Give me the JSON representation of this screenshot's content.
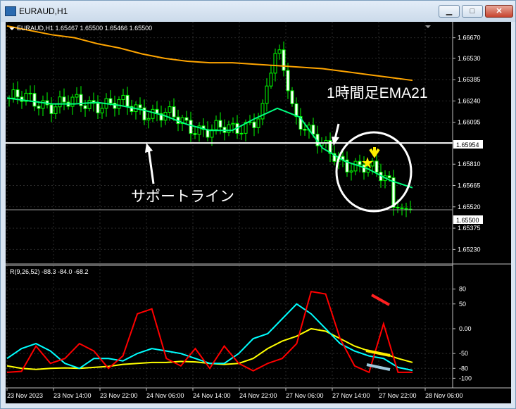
{
  "window": {
    "title": "EURAUD,H1"
  },
  "main_chart": {
    "header": "EURAUD,H1  1.65467 1.65500 1.65466 1.65500",
    "price_ticks": [
      "1.66670",
      "1.66530",
      "1.66385",
      "1.66240",
      "1.66095",
      "1.65954",
      "1.65810",
      "1.65665",
      "1.65520",
      "1.65500",
      "1.65375",
      "1.65230"
    ],
    "support_price_label": "1.65954",
    "current_price_label": "1.65500",
    "ylim": [
      1.6516,
      1.6674
    ]
  },
  "annotations": {
    "ema_label": "1時間足EMA21",
    "support_label": "サポートライン"
  },
  "indicator": {
    "header": "R(9,26,52) -88.3 -84.0 -68.2",
    "ticks": [
      "80",
      "50",
      "0.00",
      "-50",
      "-80",
      "-100"
    ],
    "ylim": [
      -108,
      88
    ]
  },
  "time_axis": {
    "labels": [
      "23 Nov 2023",
      "23 Nov 14:00",
      "23 Nov 22:00",
      "24 Nov 06:00",
      "24 Nov 14:00",
      "24 Nov 22:00",
      "27 Nov 06:00",
      "27 Nov 14:00",
      "27 Nov 22:00",
      "28 Nov 06:00"
    ]
  },
  "colors": {
    "background": "#000000",
    "candle": "#00ff00",
    "ema21": "#00ff7f",
    "slow_ma": "#ffa500",
    "support_line": "#ffffff",
    "indicator_fast": "#ff0000",
    "indicator_mid": "#00ffff",
    "indicator_slow": "#ffff00",
    "annotation_circle": "#ffffff",
    "marker_star": "#ffee00"
  },
  "chart_data": [
    {
      "type": "candlestick",
      "title": "EURAUD,H1",
      "ylim": [
        1.6516,
        1.6674
      ],
      "series": [
        {
          "name": "EMA21",
          "values": [
            1.6626,
            1.6624,
            1.6622,
            1.6622,
            1.6623,
            1.6621,
            1.6618,
            1.6614,
            1.6608,
            1.6604,
            1.6604,
            1.6612,
            1.6619,
            1.6613,
            1.6592,
            1.6583,
            1.6578,
            1.657,
            1.6565
          ]
        },
        {
          "name": "",
          "values": [
            1.6675,
            1.6672,
            1.6669,
            1.6667,
            1.6663,
            1.666,
            1.6656,
            1.6653,
            1.6651,
            1.665,
            1.665,
            1.6649,
            1.6648,
            1.6647,
            1.6646,
            1.6644,
            1.6642,
            1.664,
            1.6638
          ]
        }
      ],
      "support_level": 1.65954,
      "last_price": 1.655
    },
    {
      "type": "line",
      "title": "R(9,26,52)",
      "ylim": [
        -108,
        88
      ],
      "last_values": [
        -88.3,
        -84.0,
        -68.2
      ],
      "series": [
        {
          "name": "",
          "values": [
            -88,
            -86,
            -35,
            -70,
            -60,
            -30,
            -45,
            -80,
            -55,
            30,
            40,
            -60,
            -75,
            -40,
            -80,
            -35,
            -70,
            -85,
            -70,
            -60,
            -30,
            75,
            70,
            -20,
            -75,
            -88,
            10,
            -88,
            -88
          ]
        },
        {
          "name": "",
          "values": [
            -60,
            -40,
            -30,
            -45,
            -70,
            -80,
            -60,
            -60,
            -65,
            -50,
            -40,
            -45,
            -50,
            -60,
            -70,
            -70,
            -50,
            -20,
            -10,
            20,
            50,
            30,
            0,
            -30,
            -45,
            -55,
            -60,
            -78,
            -84
          ]
        },
        {
          "name": "",
          "values": [
            -75,
            -80,
            -82,
            -80,
            -79,
            -80,
            -78,
            -76,
            -72,
            -70,
            -68,
            -68,
            -66,
            -67,
            -70,
            -72,
            -70,
            -60,
            -40,
            -25,
            -15,
            0,
            -5,
            -20,
            -35,
            -45,
            -50,
            -60,
            -68
          ]
        }
      ]
    }
  ]
}
